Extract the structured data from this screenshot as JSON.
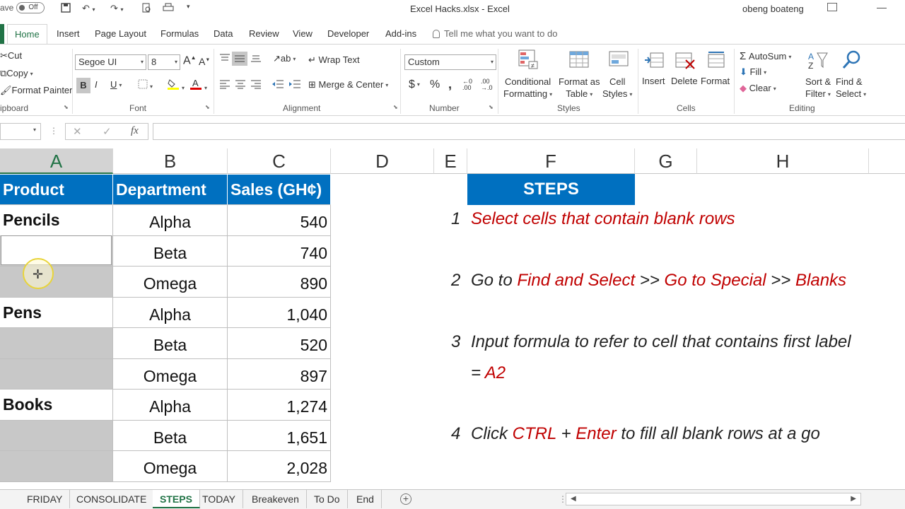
{
  "titlebar": {
    "autosave_label": "ave",
    "autosave_state": "Off",
    "doc_title": "Excel Hacks.xlsx  -  Excel",
    "user": "obeng boateng"
  },
  "tabs": [
    "Home",
    "Insert",
    "Page Layout",
    "Formulas",
    "Data",
    "Review",
    "View",
    "Developer",
    "Add-ins"
  ],
  "tell_me": "Tell me what you want to do",
  "ribbon": {
    "clipboard": {
      "cut": "Cut",
      "copy": "Copy",
      "format_painter": "Format Painter",
      "label": "ipboard"
    },
    "font": {
      "name": "Segoe UI",
      "size": "8",
      "label": "Font"
    },
    "alignment": {
      "wrap": "Wrap Text",
      "merge": "Merge & Center",
      "label": "Alignment"
    },
    "number": {
      "format": "Custom",
      "currency": "$",
      "percent": "%",
      "comma": ",",
      "label": "Number"
    },
    "styles": {
      "conditional": "Conditional",
      "conditional2": "Formatting",
      "format_table": "Format as",
      "format_table2": "Table",
      "cell_styles": "Cell",
      "cell_styles2": "Styles",
      "label": "Styles"
    },
    "cells": {
      "insert": "Insert",
      "delete": "Delete",
      "format": "Format",
      "label": "Cells"
    },
    "editing": {
      "autosum": "AutoSum",
      "fill": "Fill",
      "clear": "Clear",
      "sort": "Sort &",
      "sort2": "Filter",
      "find": "Find &",
      "find2": "Select",
      "label": "Editing"
    }
  },
  "formula_bar": {
    "fx": "fx",
    "value": ""
  },
  "columns": [
    "A",
    "B",
    "C",
    "D",
    "E",
    "F",
    "G",
    "H"
  ],
  "table": {
    "headers": [
      "Product",
      "Department",
      "Sales (GH¢)"
    ],
    "rows": [
      {
        "product": "Pencils",
        "dept": "Alpha",
        "sales": "540"
      },
      {
        "product": "",
        "dept": "Beta",
        "sales": "740"
      },
      {
        "product": "",
        "dept": "Omega",
        "sales": "890"
      },
      {
        "product": "Pens",
        "dept": "Alpha",
        "sales": "1,040"
      },
      {
        "product": "",
        "dept": "Beta",
        "sales": "520"
      },
      {
        "product": "",
        "dept": "Omega",
        "sales": "897"
      },
      {
        "product": "Books",
        "dept": "Alpha",
        "sales": "1,274"
      },
      {
        "product": "",
        "dept": "Beta",
        "sales": "1,651"
      },
      {
        "product": "",
        "dept": "Omega",
        "sales": "2,028"
      }
    ]
  },
  "steps": {
    "title": "STEPS",
    "s1": {
      "num": "1",
      "text": "Select cells that contain blank rows"
    },
    "s2": {
      "num": "2",
      "a": "Go to ",
      "b": "Find and Select",
      "c": " >> ",
      "d": "Go to Special",
      "e": " >> ",
      "f": "Blanks"
    },
    "s3": {
      "num": "3",
      "text": "Input formula to refer to cell that contains first label",
      "eq": "= ",
      "ref": "A2"
    },
    "s4": {
      "num": "4",
      "a": "Click ",
      "b": "CTRL",
      "c": " + ",
      "d": "Enter",
      "e": " to fill all blank rows at a go"
    }
  },
  "sheets": [
    "FRIDAY",
    "CONSOLIDATE",
    "STEPS",
    "TODAY",
    "Breakeven",
    "To Do",
    "End"
  ],
  "active_sheet": "STEPS",
  "colors": {
    "accent": "#217346",
    "header_blue": "#0070c0",
    "red": "#c00000",
    "blank_gray": "#c8c8c8"
  }
}
